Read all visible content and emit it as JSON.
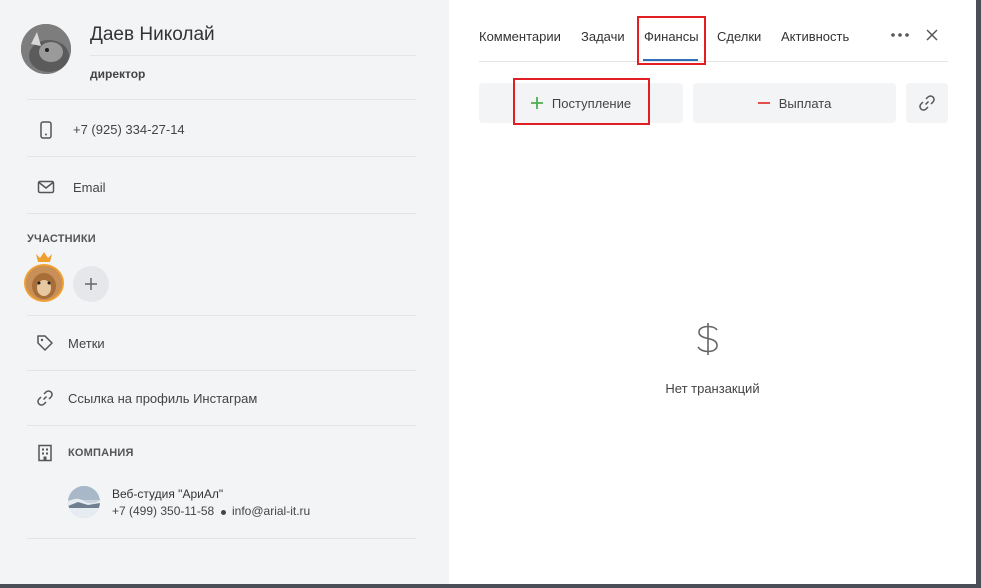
{
  "contact": {
    "name": "Даев Николай",
    "role": "директор",
    "phone": "+7 (925) 334-27-14",
    "email_label": "Email"
  },
  "participants": {
    "label": "УЧАСТНИКИ"
  },
  "tags_label": "Метки",
  "instagram_label": "Ссылка на профиль Инстаграм",
  "company": {
    "label": "КОМПАНИЯ",
    "name": "Веб-студия \"АриАл\"",
    "phone": "+7 (499) 350-11-58",
    "email": "info@arial-it.ru"
  },
  "tabs": [
    {
      "label": "Комментарии"
    },
    {
      "label": "Задачи"
    },
    {
      "label": "Финансы",
      "active": true
    },
    {
      "label": "Сделки"
    },
    {
      "label": "Активность"
    }
  ],
  "actions": {
    "income_label": "Поступление",
    "payout_label": "Выплата"
  },
  "empty_state": {
    "text": "Нет транзакций"
  },
  "colors": {
    "accent": "#2f6db5",
    "highlight": "#e01e24",
    "income": "#4caf50",
    "payout": "#e53935"
  }
}
